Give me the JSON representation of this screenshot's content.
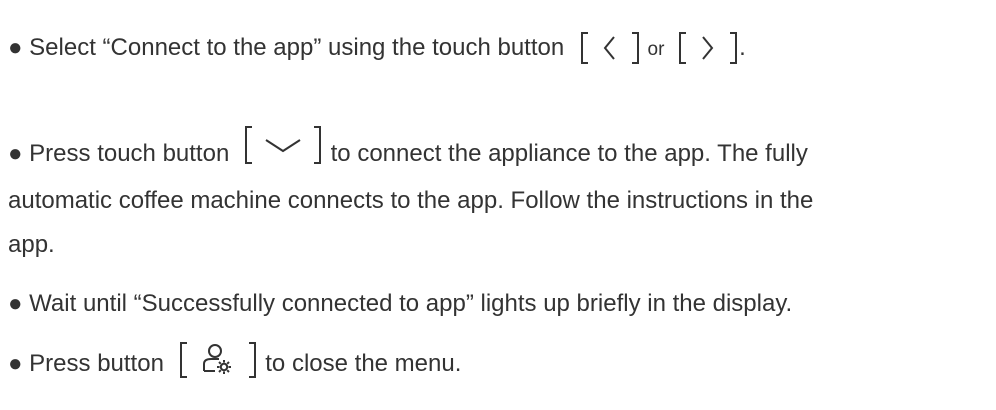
{
  "bullet": "●",
  "steps": [
    {
      "text_before": "Select “Connect to the app” using the touch button",
      "icon_left": "chevron-left-icon",
      "or_word": "or",
      "icon_right": "chevron-right-icon",
      "text_after": "."
    },
    {
      "text_before": "Press touch button",
      "icon": "chevron-down-icon",
      "text_after_line1": "to connect the appliance to the app. The fully",
      "text_line2": "automatic coffee machine connects to the app. Follow the instructions in the",
      "text_line3": "app."
    },
    {
      "text": "Wait until “Successfully connected to app” lights up briefly in the display."
    },
    {
      "text_before": "Press button",
      "icon": "user-settings-icon",
      "text_after": "to close the menu."
    }
  ],
  "colors": {
    "text": "#333333",
    "icon": "#333333"
  }
}
